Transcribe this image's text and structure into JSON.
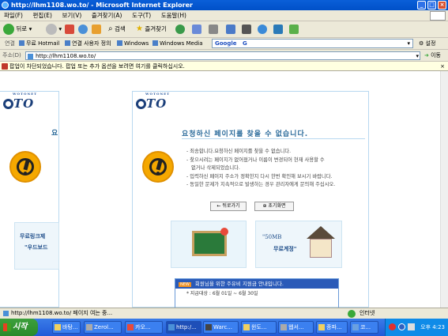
{
  "window": {
    "title": "http://lhm1108.wo.to/ - Microsoft Internet Explorer"
  },
  "menu": [
    "파일(F)",
    "편집(E)",
    "보기(V)",
    "즐겨찾기(A)",
    "도구(T)",
    "도움말(H)"
  ],
  "toolbar": {
    "back": "뒤로",
    "search": "검색",
    "favorites": "즐겨찾기"
  },
  "links": {
    "label": "연결",
    "items": [
      "무료 Hotmail",
      "연결 사용자 정의",
      "Windows",
      "Windows Media"
    ],
    "google": "Google",
    "google_g": "G",
    "settings": "설정"
  },
  "address": {
    "label": "주소(D)",
    "url": "http://lhm1108.wo.to/",
    "go": "이동"
  },
  "infobar": {
    "text": "팝업이 차단되었습니다. 팝업 또는 추가 옵션을 보려면 여기를 클릭하십시오."
  },
  "page": {
    "logo_text": "WOTO",
    "logo_sub": "WOTONET",
    "heading": "요청하신 페이지를 찾을 수 없습니다.",
    "left_heading_fragment": "요",
    "messages": [
      "- 죄송합니다.요청하신 페이지를 찾을 수 없습니다.",
      "- 찾으시려는 페이지가 없어졌거나 이름이 변경되어 현재 사용할 수",
      "  없거나 삭제되었습니다.",
      "- 입력하신 페이지 주소가 정확한지 다시 한번 확인해 보시기 바랍니다.",
      "- 동일한 문제가 지속적으로 발생하는 경우 관리자에게 문의해 주십시오."
    ],
    "back_button": "← 뒤로가기",
    "home_button": "⊕ 초기화면",
    "promo_left_1": "무료링크제",
    "promo_left_2": "\"우드보드",
    "promo_right_1": "\"50MB",
    "promo_right_2": "무료계정\"",
    "notice_badge": "NEW",
    "notice_title": "회원님을 위한 주유비 지원금 안내입니다.",
    "notice_line": "* 지급대상 : 6월 01일 ~ 6월 30일"
  },
  "status": {
    "text": "http://lhm1108.wo.to/ 페이지 여는 중...",
    "zone": "인터넷"
  },
  "taskbar": {
    "start": "시작",
    "tasks": [
      "바탕...",
      "Zerol...",
      "카오...",
      "http:/...",
      "Warc...",
      "윈도...",
      "웹서...",
      "종파...",
      "코..."
    ],
    "clock": "오후 4:23"
  }
}
